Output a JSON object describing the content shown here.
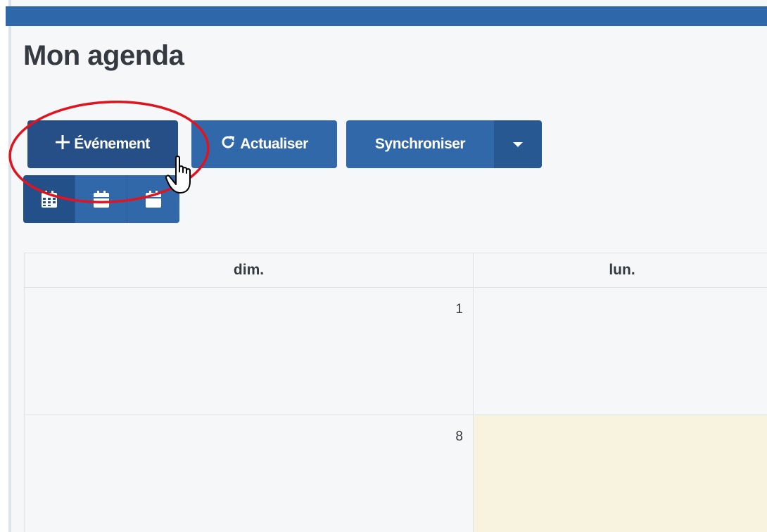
{
  "page": {
    "title": "Mon agenda"
  },
  "toolbar": {
    "event_label": "Événement",
    "refresh_label": "Actualiser",
    "sync_label": "Synchroniser"
  },
  "calendar": {
    "headers": [
      "dim.",
      "lun."
    ],
    "rows": [
      {
        "sunday": "1",
        "monday": ""
      },
      {
        "sunday": "8",
        "monday": ""
      }
    ]
  },
  "colors": {
    "topbar": "#2f67ab",
    "button": "#3068aa",
    "button_active": "#254f86",
    "today_highlight": "#f8f3de",
    "annotation": "#e0141e"
  },
  "icons": [
    "plus-icon",
    "refresh-icon",
    "caret-down-icon",
    "month-view-icon",
    "week-view-icon",
    "day-view-icon",
    "hand-cursor-icon"
  ]
}
